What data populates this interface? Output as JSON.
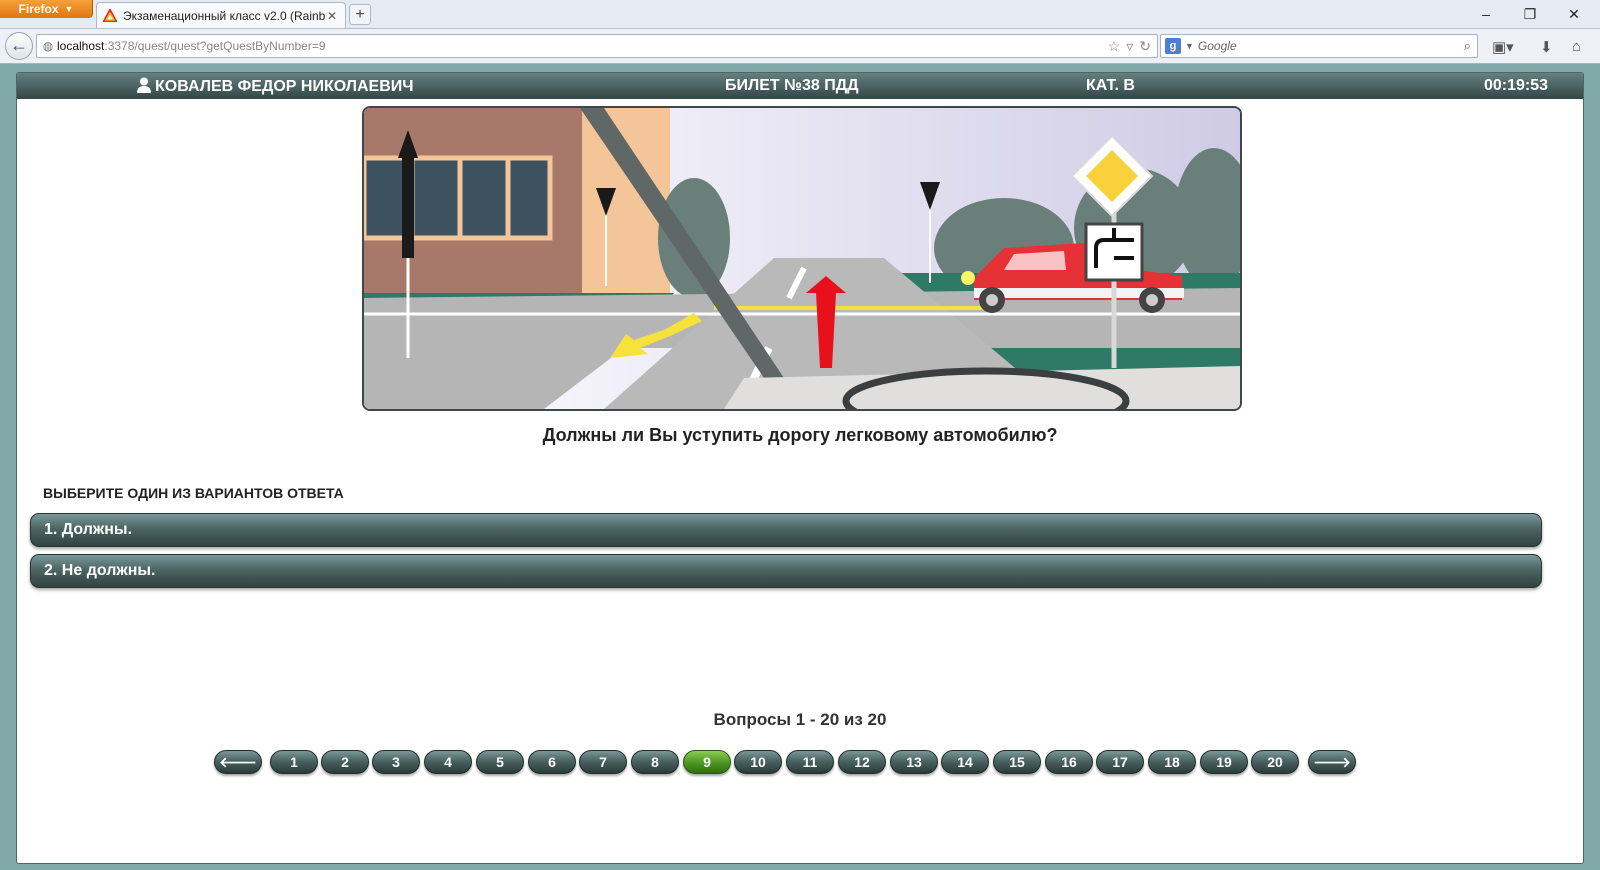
{
  "browser": {
    "menu_button": "Firefox",
    "tab_title": "Экзаменационный класс v2.0 (Rainbow...",
    "new_tab": "+",
    "url_host": "localhost",
    "url_rest": ":3378/quest/quest?getQuestByNumber=9",
    "search_placeholder": "Google",
    "search_engine_letter": "g"
  },
  "header": {
    "student_name": "КОВАЛЕВ ФЕДОР НИКОЛАЕВИЧ",
    "ticket": "БИЛЕТ №38 ПДД",
    "category": "КАТ. В",
    "timer": "00:19:53"
  },
  "question": {
    "text": "Должны ли Вы уступить дорогу легковому автомобилю?",
    "choose_label": "ВЫБЕРИТЕ ОДИН ИЗ ВАРИАНТОВ ОТВЕТА",
    "answers": [
      "1. Должны.",
      "2. Не должны."
    ]
  },
  "pager": {
    "label": "Вопросы 1 - 20 из 20",
    "prev": "🡐",
    "next": "🡒",
    "pages": [
      "1",
      "2",
      "3",
      "4",
      "5",
      "6",
      "7",
      "8",
      "9",
      "10",
      "11",
      "12",
      "13",
      "14",
      "15",
      "16",
      "17",
      "18",
      "19",
      "20"
    ],
    "active_page": "9"
  },
  "colors": {
    "header_bar": "#324645",
    "answer_bar": "#4d6564",
    "active_page": "#4f9a25",
    "page_background": "#7fa9a8"
  }
}
